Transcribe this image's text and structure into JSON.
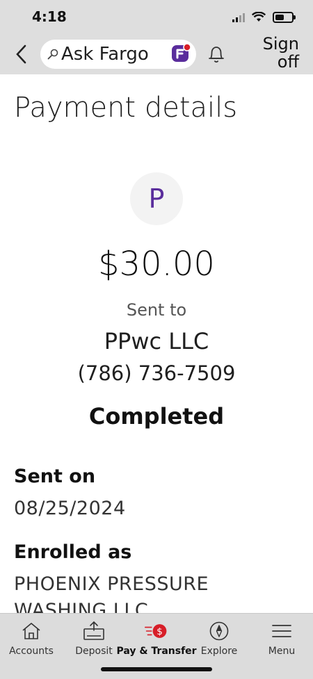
{
  "status_bar": {
    "time": "4:18"
  },
  "header": {
    "search_label": "Ask Fargo",
    "signoff_line1": "Sign",
    "signoff_line2": "off"
  },
  "page": {
    "title": "Payment details",
    "avatar_initial": "P",
    "amount": "$30.00",
    "sent_to_label": "Sent to",
    "payee_name": "PPwc LLC",
    "payee_phone": "(786) 736-7509",
    "status": "Completed",
    "sent_on_label": "Sent on",
    "sent_on_value": "08/25/2024",
    "enrolled_label": "Enrolled as",
    "enrolled_value": "PHOENIX PRESSURE WASHING LLC"
  },
  "bottom_nav": {
    "items": [
      {
        "label": "Accounts",
        "icon": "home-icon"
      },
      {
        "label": "Deposit",
        "icon": "deposit-icon"
      },
      {
        "label": "Pay & Transfer",
        "icon": "pay-transfer-icon"
      },
      {
        "label": "Explore",
        "icon": "compass-icon"
      },
      {
        "label": "Menu",
        "icon": "menu-icon"
      }
    ]
  },
  "colors": {
    "header_bg": "#dedede",
    "accent_red": "#d71e28",
    "avatar_purple": "#5a2d9c"
  }
}
